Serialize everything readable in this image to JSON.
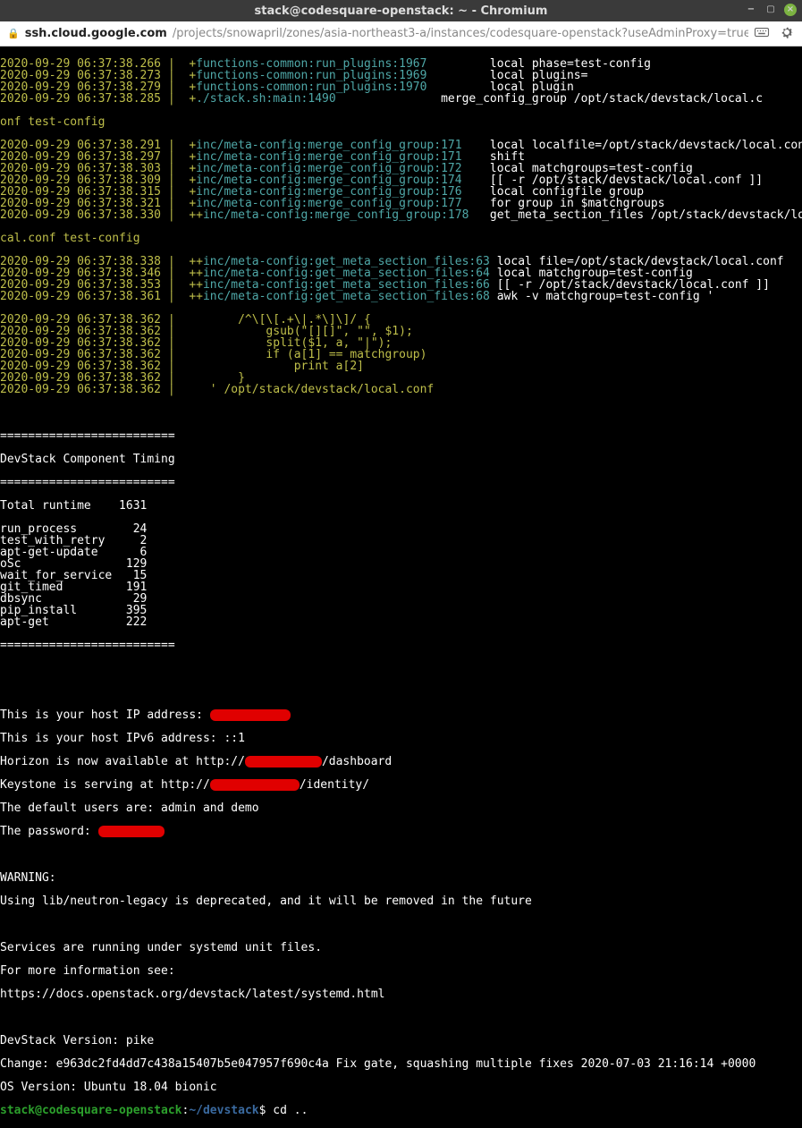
{
  "window": {
    "title": "stack@codesquare-openstack: ~ - Chromium",
    "min_icon": "−",
    "max_icon": "▢",
    "close_icon": "×"
  },
  "urlbar": {
    "host": "ssh.cloud.google.com",
    "path": "/projects/snowapril/zones/asia-northeast3-a/instances/codesquare-openstack?useAdminProxy=true&aut…"
  },
  "log_lines": [
    {
      "ts": "2020-09-29 06:37:38.266 |  +",
      "fn": "functions-common:run_plugins:1967",
      "msg": "         local phase=test-config"
    },
    {
      "ts": "2020-09-29 06:37:38.273 |  +",
      "fn": "functions-common:run_plugins:1969",
      "msg": "         local plugins="
    },
    {
      "ts": "2020-09-29 06:37:38.279 |  +",
      "fn": "functions-common:run_plugins:1970",
      "msg": "         local plugin"
    },
    {
      "ts": "2020-09-29 06:37:38.285 |  +",
      "fn": "./stack.sh:main:1490",
      "msg": "               merge_config_group /opt/stack/devstack/local.c"
    }
  ],
  "log_cont": "onf test-config",
  "mc_lines": [
    {
      "ts": "2020-09-29 06:37:38.291 |  +",
      "fn": "inc/meta-config:merge_config_group:171",
      "msg": "    local localfile=/opt/stack/devstack/local.conf"
    },
    {
      "ts": "2020-09-29 06:37:38.297 |  +",
      "fn": "inc/meta-config:merge_config_group:171",
      "msg": "    shift"
    },
    {
      "ts": "2020-09-29 06:37:38.303 |  +",
      "fn": "inc/meta-config:merge_config_group:172",
      "msg": "    local matchgroups=test-config"
    },
    {
      "ts": "2020-09-29 06:37:38.309 |  +",
      "fn": "inc/meta-config:merge_config_group:174",
      "msg": "    [[ -r /opt/stack/devstack/local.conf ]]"
    },
    {
      "ts": "2020-09-29 06:37:38.315 |  +",
      "fn": "inc/meta-config:merge_config_group:176",
      "msg": "    local configfile group"
    },
    {
      "ts": "2020-09-29 06:37:38.321 |  +",
      "fn": "inc/meta-config:merge_config_group:177",
      "msg": "    for group in $matchgroups"
    },
    {
      "ts": "2020-09-29 06:37:38.330 |  ++",
      "fn": "inc/meta-config:merge_config_group:178",
      "msg": "   get_meta_section_files /opt/stack/devstack/lo"
    }
  ],
  "mc_cont": "cal.conf test-config",
  "gms_lines": [
    {
      "ts": "2020-09-29 06:37:38.338 |  ++",
      "fn": "inc/meta-config:get_meta_section_files:63",
      "msg": " local file=/opt/stack/devstack/local.conf"
    },
    {
      "ts": "2020-09-29 06:37:38.346 |  ++",
      "fn": "inc/meta-config:get_meta_section_files:64",
      "msg": " local matchgroup=test-config"
    },
    {
      "ts": "2020-09-29 06:37:38.353 |  ++",
      "fn": "inc/meta-config:get_meta_section_files:66",
      "msg": " [[ -r /opt/stack/devstack/local.conf ]]"
    },
    {
      "ts": "2020-09-29 06:37:38.361 |  ++",
      "fn": "inc/meta-config:get_meta_section_files:68",
      "msg": " awk -v matchgroup=test-config '"
    }
  ],
  "awk_lines": [
    "2020-09-29 06:37:38.362 |         /^\\[\\[.+\\|.*\\]\\]/ {",
    "2020-09-29 06:37:38.362 |             gsub(\"[][]\", \"\", $1);",
    "2020-09-29 06:37:38.362 |             split($1, a, \"|\");",
    "2020-09-29 06:37:38.362 |             if (a[1] == matchgroup)",
    "2020-09-29 06:37:38.362 |                 print a[2]",
    "2020-09-29 06:37:38.362 |         }",
    "2020-09-29 06:37:38.362 |     ' /opt/stack/devstack/local.conf"
  ],
  "sep": "=========================",
  "timing_header": "DevStack Component Timing",
  "timing": [
    "Total runtime    1631",
    "",
    "run_process        24",
    "test_with_retry     2",
    "apt-get-update      6",
    "oSc               129",
    "wait_for_service   15",
    "git_timed         191",
    "dbsync             29",
    "pip_install       395",
    "apt-get           222"
  ],
  "footer": {
    "ip_label": "This is your host IP address: ",
    "ipv6": "This is your host IPv6 address: ::1",
    "horizon_pre": "Horizon is now available at http://",
    "horizon_post": "/dashboard",
    "keystone_pre": "Keystone is serving at http://",
    "keystone_post": "/identity/",
    "default_users": "The default users are: admin and demo",
    "password_label": "The password: ",
    "warning_head": "WARNING:",
    "warning_body": "Using lib/neutron-legacy is deprecated, and it will be removed in the future",
    "services1": "Services are running under systemd unit files.",
    "services2": "For more information see:",
    "services3": "https://docs.openstack.org/devstack/latest/systemd.html",
    "version": "DevStack Version: pike",
    "change": "Change: e963dc2fd4dd7c438a15407b5e047957f690c4a Fix gate, squashing multiple fixes 2020-07-03 21:16:14 +0000",
    "os": "OS Version: Ubuntu 18.04 bionic"
  },
  "prompt": {
    "user": "stack@codesquare-openstack",
    "sep": ":",
    "path": "~/devstack",
    "cmd": "$ cd .."
  }
}
